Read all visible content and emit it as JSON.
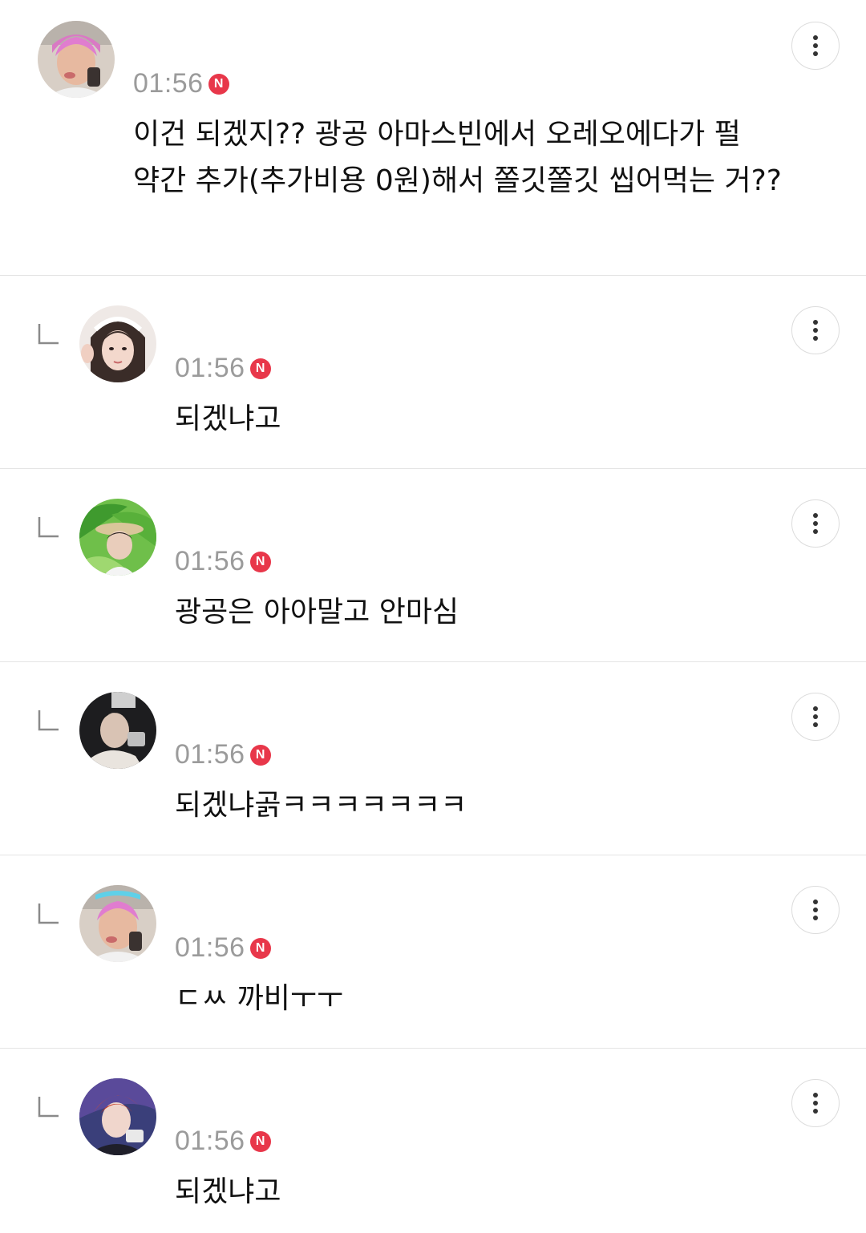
{
  "comments": [
    {
      "time": "01:56",
      "badge": "N",
      "text": "이건 되겠지?? 광공 아마스빈에서 오레오에다가 펄 약간 추가(추가비용 0원)해서 쫄깃쫄깃 씹어먹는 거??",
      "is_reply": false
    },
    {
      "time": "01:56",
      "badge": "N",
      "text": "되겠냐고",
      "is_reply": true
    },
    {
      "time": "01:56",
      "badge": "N",
      "text": "광공은 아아말고 안마심",
      "is_reply": true
    },
    {
      "time": "01:56",
      "badge": "N",
      "text": "되겠냐곩ㅋㅋㅋㅋㅋㅋㅋ",
      "is_reply": true
    },
    {
      "time": "01:56",
      "badge": "N",
      "text": "ㄷㅆ 까비ㅜㅜ",
      "is_reply": true
    },
    {
      "time": "01:56",
      "badge": "N",
      "text": "되겠냐고",
      "is_reply": true
    }
  ],
  "icons": {
    "more": "more-vertical-icon",
    "reply": "reply-arrow-icon",
    "badge_color": "#e8374a"
  }
}
